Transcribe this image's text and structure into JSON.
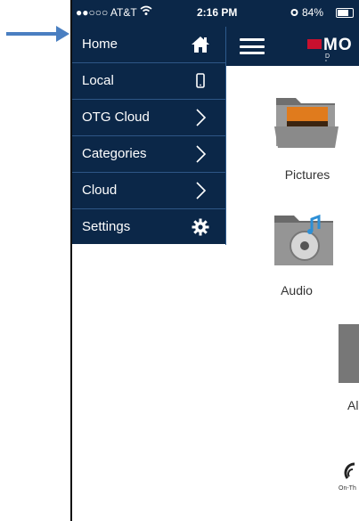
{
  "status_bar": {
    "carrier": "●●○○○ AT&T",
    "time": "2:16 PM",
    "battery": "84%"
  },
  "drawer": {
    "items": [
      {
        "label": "Home",
        "icon": "home-icon"
      },
      {
        "label": "Local",
        "icon": "phone-icon"
      },
      {
        "label": "OTG Cloud",
        "icon": "chevron-right-icon"
      },
      {
        "label": "Categories",
        "icon": "chevron-right-icon"
      },
      {
        "label": "Cloud",
        "icon": "chevron-right-icon"
      },
      {
        "label": "Settings",
        "icon": "gear-icon"
      }
    ]
  },
  "header": {
    "logo_text": "MO",
    "logo_sub": "D I"
  },
  "tiles": {
    "pictures": "Pictures",
    "audio": "Audio",
    "partial_third": "Al"
  },
  "footer_logo_text": "On-Th",
  "colors": {
    "nav_bg": "#0b2748",
    "divider": "#2e5686",
    "annotation_arrow": "#4a7fc1"
  }
}
